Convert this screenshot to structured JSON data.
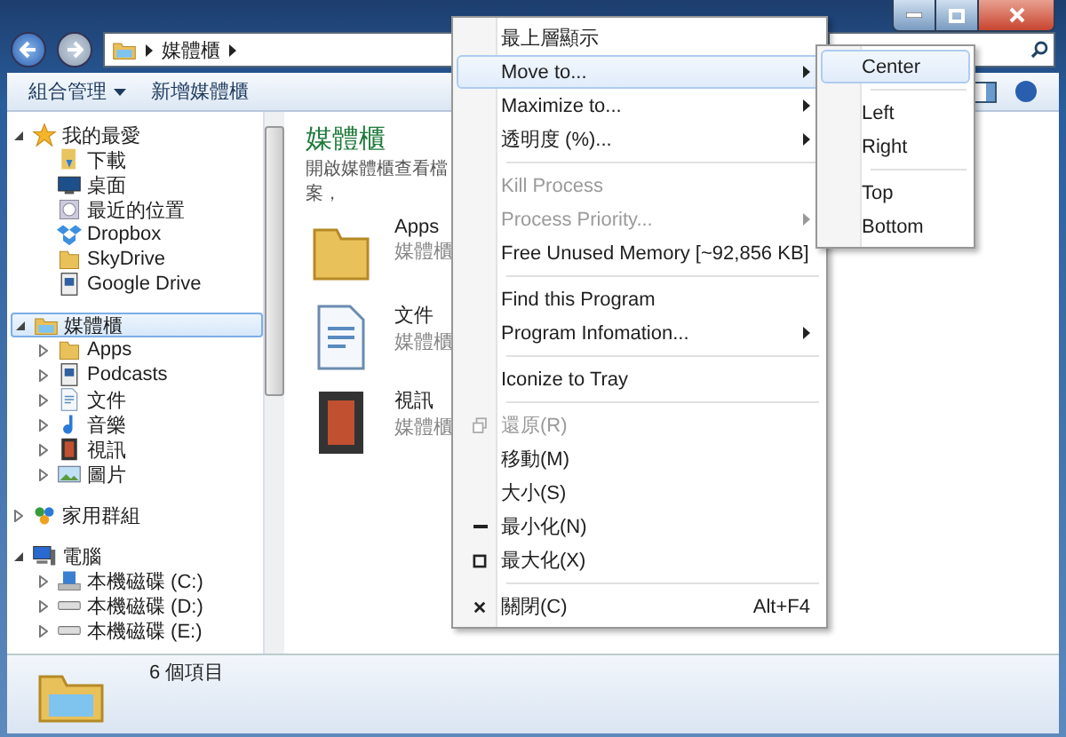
{
  "address": {
    "crumbs": [
      "媒體櫃"
    ]
  },
  "toolbar": {
    "buttons": [
      {
        "label": "組合管理",
        "dropdown": true
      },
      {
        "label": "新增媒體櫃",
        "dropdown": false
      }
    ]
  },
  "sidebar": {
    "groups": [
      {
        "label": "我的最愛",
        "expanded": true,
        "selected": false,
        "children": [
          {
            "label": "下載"
          },
          {
            "label": "桌面"
          },
          {
            "label": "最近的位置"
          },
          {
            "label": "Dropbox"
          },
          {
            "label": "SkyDrive"
          },
          {
            "label": "Google Drive"
          }
        ]
      },
      {
        "label": "媒體櫃",
        "expanded": true,
        "selected": true,
        "children": [
          {
            "label": "Apps",
            "expandable": true
          },
          {
            "label": "Podcasts",
            "expandable": true
          },
          {
            "label": "文件",
            "expandable": true
          },
          {
            "label": "音樂",
            "expandable": true
          },
          {
            "label": "視訊",
            "expandable": true
          },
          {
            "label": "圖片",
            "expandable": true
          }
        ]
      },
      {
        "label": "家用群組",
        "expanded": false,
        "selected": false
      },
      {
        "label": "電腦",
        "expanded": true,
        "selected": false,
        "children": [
          {
            "label": "本機磁碟 (C:)",
            "expandable": true
          },
          {
            "label": "本機磁碟 (D:)",
            "expandable": true
          },
          {
            "label": "本機磁碟 (E:)",
            "expandable": true
          }
        ]
      }
    ]
  },
  "content": {
    "title": "媒體櫃",
    "description": "開啟媒體櫃查看檔案，",
    "items": [
      {
        "name": "Apps",
        "type": "媒體櫃"
      },
      {
        "name": "文件",
        "type": "媒體櫃"
      },
      {
        "name": "視訊",
        "type": "媒體櫃"
      }
    ]
  },
  "status_bar": {
    "text": "6 個項目"
  },
  "context_menu": {
    "items": [
      {
        "kind": "item",
        "label": "最上層顯示",
        "disabled": false,
        "submenu": false,
        "selected": false
      },
      {
        "kind": "item",
        "label": "Move to...",
        "disabled": false,
        "submenu": true,
        "selected": true
      },
      {
        "kind": "item",
        "label": "Maximize to...",
        "disabled": false,
        "submenu": true,
        "selected": false
      },
      {
        "kind": "item",
        "label": "透明度 (%)...",
        "disabled": false,
        "submenu": true,
        "selected": false
      },
      {
        "kind": "separator"
      },
      {
        "kind": "item",
        "label": "Kill Process",
        "disabled": true,
        "submenu": false,
        "selected": false
      },
      {
        "kind": "item",
        "label": "Process Priority...",
        "disabled": true,
        "submenu": true,
        "selected": false
      },
      {
        "kind": "item",
        "label": "Free Unused Memory [~92,856 KB]",
        "disabled": false,
        "submenu": false,
        "selected": false
      },
      {
        "kind": "separator"
      },
      {
        "kind": "item",
        "label": "Find this Program",
        "disabled": false,
        "submenu": false,
        "selected": false
      },
      {
        "kind": "item",
        "label": "Program Infomation...",
        "disabled": false,
        "submenu": true,
        "selected": false
      },
      {
        "kind": "separator"
      },
      {
        "kind": "item",
        "label": "Iconize to Tray",
        "disabled": false,
        "submenu": false,
        "selected": false
      },
      {
        "kind": "separator"
      },
      {
        "kind": "item",
        "label": "還原(R)",
        "disabled": true,
        "submenu": false,
        "selected": false
      },
      {
        "kind": "item",
        "label": "移動(M)",
        "disabled": false,
        "submenu": false,
        "selected": false
      },
      {
        "kind": "item",
        "label": "大小(S)",
        "disabled": false,
        "submenu": false,
        "selected": false
      },
      {
        "kind": "item",
        "label": "最小化(N)",
        "disabled": false,
        "submenu": false,
        "selected": false
      },
      {
        "kind": "item",
        "label": "最大化(X)",
        "disabled": false,
        "submenu": false,
        "selected": false
      },
      {
        "kind": "separator"
      },
      {
        "kind": "item",
        "label": "關閉(C)",
        "disabled": false,
        "submenu": false,
        "selected": false,
        "shortcut": "Alt+F4"
      }
    ]
  },
  "submenu": {
    "items": [
      {
        "kind": "item",
        "label": "Center",
        "selected": true
      },
      {
        "kind": "separator"
      },
      {
        "kind": "item",
        "label": "Left",
        "selected": false
      },
      {
        "kind": "item",
        "label": "Right",
        "selected": false
      },
      {
        "kind": "separator"
      },
      {
        "kind": "item",
        "label": "Top",
        "selected": false
      },
      {
        "kind": "item",
        "label": "Bottom",
        "selected": false
      }
    ]
  }
}
